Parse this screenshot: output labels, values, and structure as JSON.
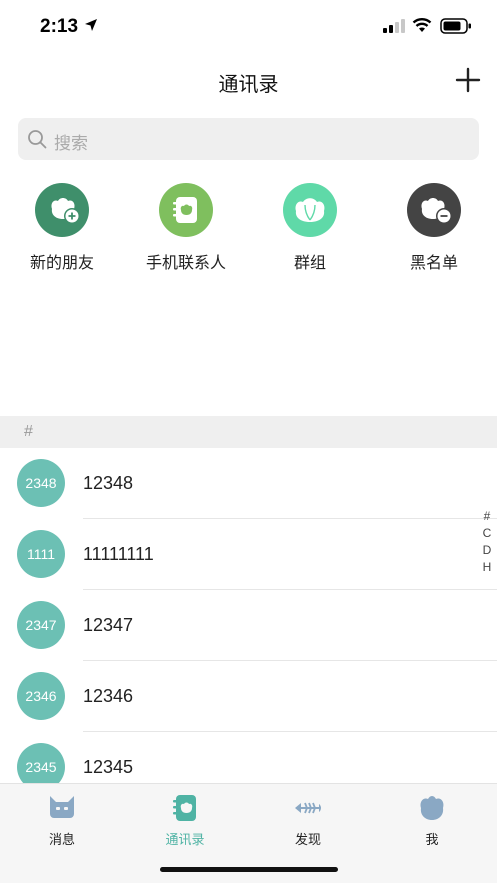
{
  "status_bar": {
    "time": "2:13"
  },
  "header": {
    "title": "通讯录"
  },
  "search": {
    "placeholder": "搜索"
  },
  "quick_actions": [
    {
      "label": "新的朋友",
      "color": "#3f8f6b"
    },
    {
      "label": "手机联系人",
      "color": "#7fbf5e"
    },
    {
      "label": "群组",
      "color": "#5fd9a8"
    },
    {
      "label": "黑名单",
      "color": "#444444"
    }
  ],
  "section": {
    "letter": "#"
  },
  "contacts": [
    {
      "avatar": "2348",
      "name": "12348"
    },
    {
      "avatar": "1111",
      "name": "11111111"
    },
    {
      "avatar": "2347",
      "name": "12347"
    },
    {
      "avatar": "2346",
      "name": "12346"
    },
    {
      "avatar": "2345",
      "name": "12345"
    }
  ],
  "index": [
    "#",
    "C",
    "D",
    "H"
  ],
  "tabs": [
    {
      "label": "消息",
      "active": false
    },
    {
      "label": "通讯录",
      "active": true
    },
    {
      "label": "发现",
      "active": false
    },
    {
      "label": "我",
      "active": false
    }
  ],
  "colors": {
    "accent": "#4fb3a4",
    "avatar": "#6cc0b4",
    "tab_icon": "#8aa8c4"
  }
}
